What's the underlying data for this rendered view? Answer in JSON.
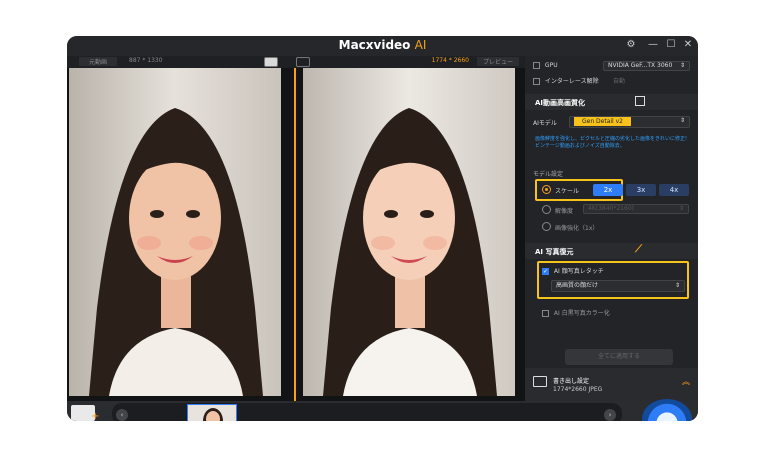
{
  "app": {
    "title_main": "Macxvideo",
    "title_ai": "AI"
  },
  "window_controls": {
    "settings": "⚙",
    "minimize": "—",
    "maximize": "☐",
    "close": "✕"
  },
  "preview": {
    "original_label": "元動画",
    "original_size": "887 * 1330",
    "output_size": "1774 * 2660",
    "preview_label": "プレビュー"
  },
  "gpu": {
    "label": "GPU",
    "device": "NVIDIA GeF...TX 3060",
    "checked": false
  },
  "deinterlace": {
    "label": "インターレース解除",
    "value": "自動"
  },
  "enhance": {
    "title": "AI動画高画質化",
    "model_label": "AIモデル",
    "model_value": "Gen Detail v2",
    "description": "画像鮮度を強化し、ピクセルと圧縮の劣化した画像をきれいに修正!ビンテージ動画およびノイズ自動除去。",
    "model_settings_label": "モデル設定",
    "scale_label": "スケール",
    "scale_options": [
      "2x",
      "3x",
      "4x"
    ],
    "scale_selected": "2x",
    "resolution_label": "解像度",
    "resolution_value": "4K(3840*2160)",
    "quality_label": "画像強化（1x）"
  },
  "restore": {
    "title": "AI 写真復元",
    "face_touch_label": "AI 顔写真レタッチ",
    "face_touch_checked": true,
    "face_touch_mode": "高画質の顔だけ",
    "colorize_label": "AI 白黒写真カラー化",
    "colorize_checked": false
  },
  "apply_all": "全てに適用する",
  "export": {
    "title": "書き出し設定",
    "detail": "1774*2660 JPEG"
  },
  "colors": {
    "accent": "#f7a21b",
    "primary": "#2f7df6",
    "highlight": "#f7c21b"
  }
}
